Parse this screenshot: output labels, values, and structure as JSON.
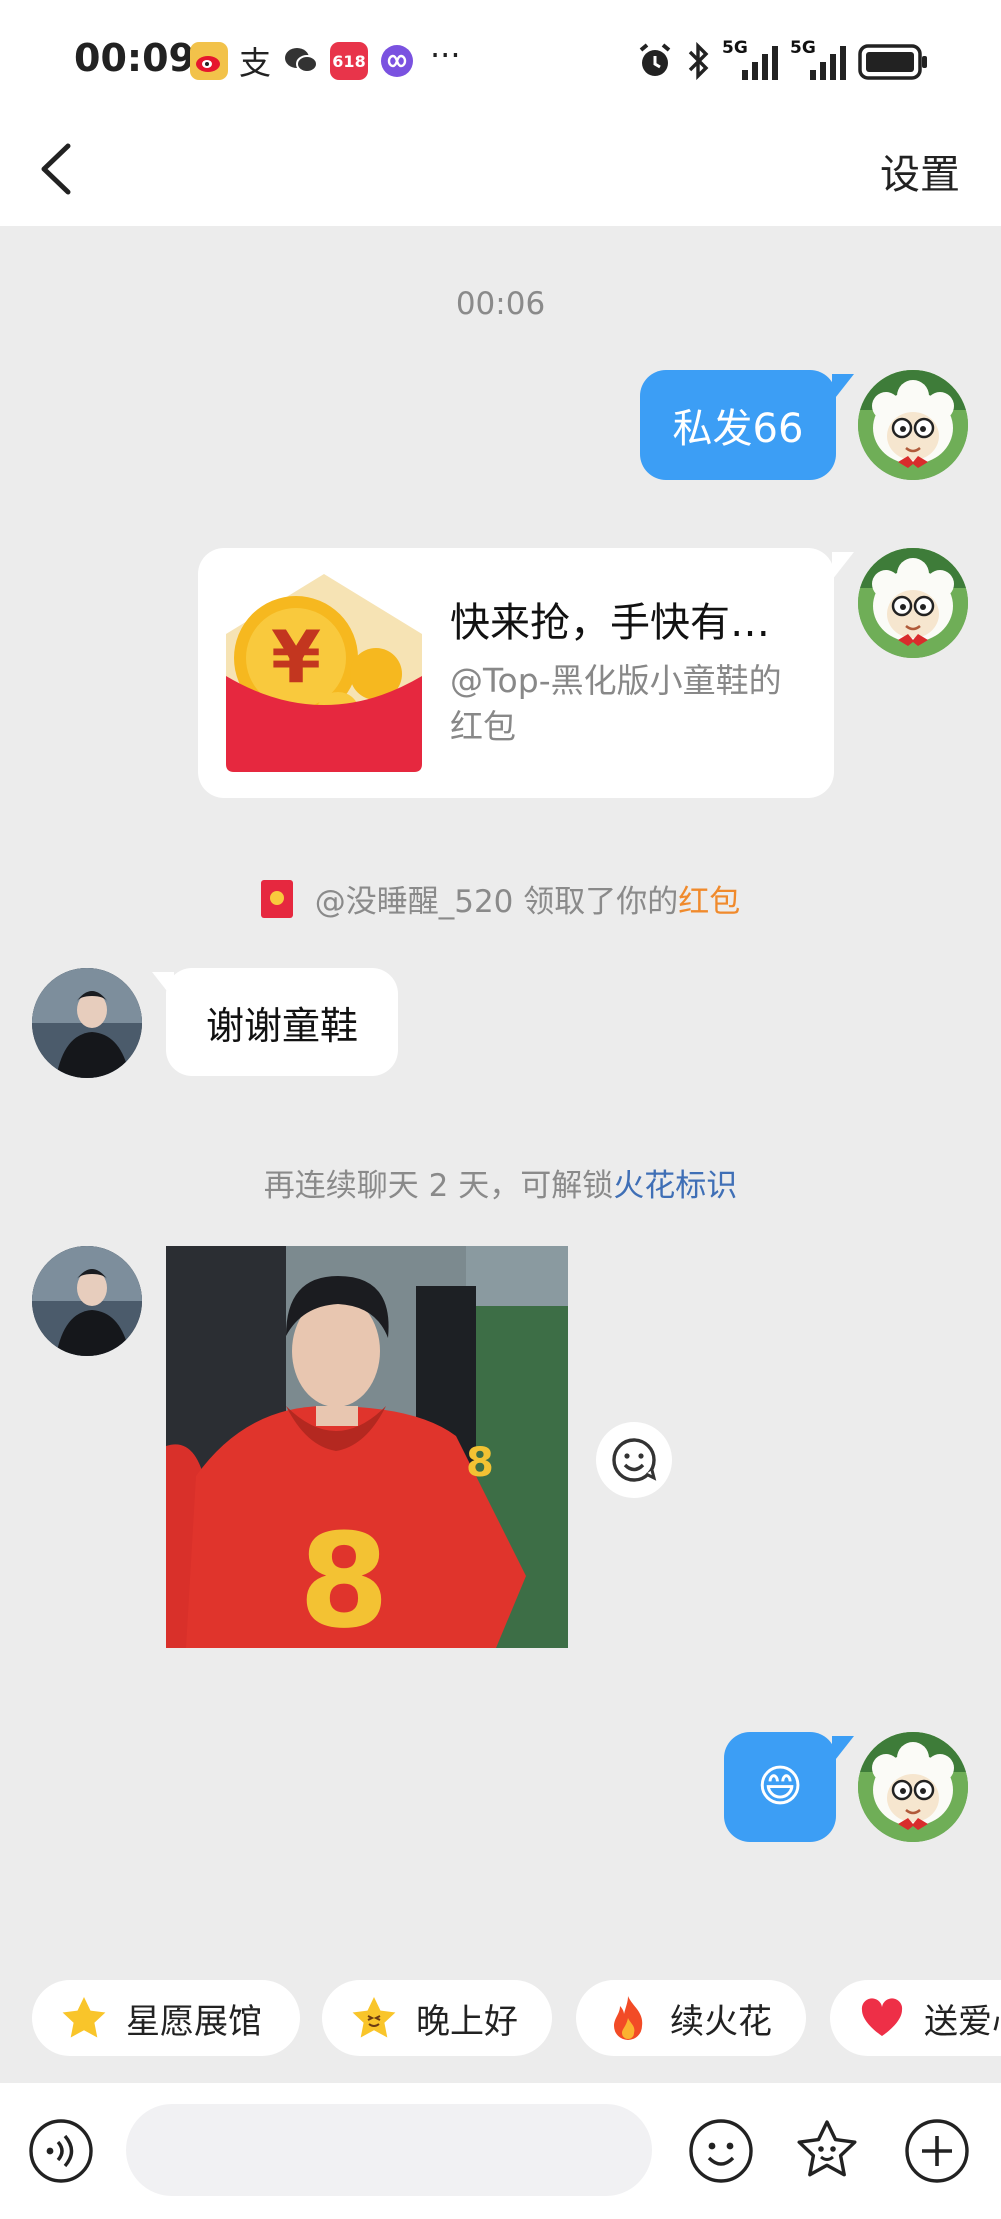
{
  "status_bar": {
    "time": "00:09",
    "app_icons": [
      "weibo-icon",
      "alipay-icon",
      "wechat-icon",
      "taobao-618-icon",
      "link-icon"
    ],
    "more": "···",
    "indicators": [
      "alarm-icon",
      "bluetooth-icon",
      "5g-signal-icon",
      "5g-signal-icon",
      "battery-icon"
    ],
    "sim1": "5G",
    "sim2": "5G"
  },
  "nav": {
    "title": "",
    "settings_label": "设置"
  },
  "messages": {
    "time_1": "00:06",
    "msg_1": "私发66",
    "red_packet": {
      "title": "快来抢，手快有…",
      "subtitle": "@Top-黑化版小童鞋的红包"
    },
    "system_1_prefix": "@没睡醒_520 领取了你的",
    "system_1_link": "红包",
    "msg_2": "谢谢童鞋",
    "system_2_prefix": "再连续聊天 2 天，可解锁",
    "system_2_link": "火花标识",
    "msg_3_emoji": "😄"
  },
  "quick_actions": [
    {
      "label": "星愿展馆",
      "icon": "star-icon"
    },
    {
      "label": "晚上好",
      "icon": "star-smile-icon"
    },
    {
      "label": "续火花",
      "icon": "fire-icon"
    },
    {
      "label": "送爱心",
      "icon": "heart-icon"
    }
  ],
  "input": {
    "placeholder": ""
  },
  "colors": {
    "accent_blue": "#3c9ef5",
    "red_packet": "#e6283f",
    "link_orange": "#f08a2c",
    "link_blue": "#3f6fb6",
    "background": "#ececec"
  }
}
